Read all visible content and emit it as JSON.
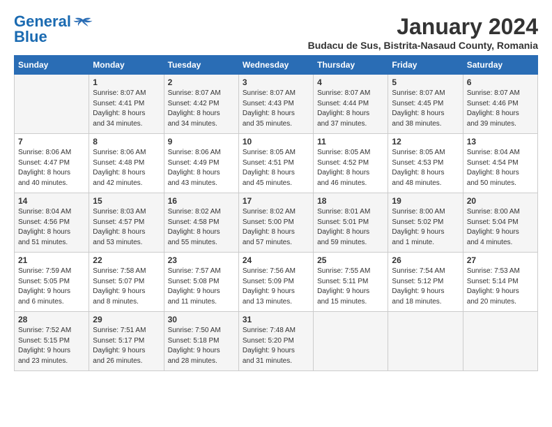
{
  "header": {
    "logo_line1": "General",
    "logo_line2": "Blue",
    "title": "January 2024",
    "subtitle": "Budacu de Sus, Bistrita-Nasaud County, Romania"
  },
  "weekdays": [
    "Sunday",
    "Monday",
    "Tuesday",
    "Wednesday",
    "Thursday",
    "Friday",
    "Saturday"
  ],
  "weeks": [
    [
      {
        "day": "",
        "info": ""
      },
      {
        "day": "1",
        "info": "Sunrise: 8:07 AM\nSunset: 4:41 PM\nDaylight: 8 hours\nand 34 minutes."
      },
      {
        "day": "2",
        "info": "Sunrise: 8:07 AM\nSunset: 4:42 PM\nDaylight: 8 hours\nand 34 minutes."
      },
      {
        "day": "3",
        "info": "Sunrise: 8:07 AM\nSunset: 4:43 PM\nDaylight: 8 hours\nand 35 minutes."
      },
      {
        "day": "4",
        "info": "Sunrise: 8:07 AM\nSunset: 4:44 PM\nDaylight: 8 hours\nand 37 minutes."
      },
      {
        "day": "5",
        "info": "Sunrise: 8:07 AM\nSunset: 4:45 PM\nDaylight: 8 hours\nand 38 minutes."
      },
      {
        "day": "6",
        "info": "Sunrise: 8:07 AM\nSunset: 4:46 PM\nDaylight: 8 hours\nand 39 minutes."
      }
    ],
    [
      {
        "day": "7",
        "info": "Sunrise: 8:06 AM\nSunset: 4:47 PM\nDaylight: 8 hours\nand 40 minutes."
      },
      {
        "day": "8",
        "info": "Sunrise: 8:06 AM\nSunset: 4:48 PM\nDaylight: 8 hours\nand 42 minutes."
      },
      {
        "day": "9",
        "info": "Sunrise: 8:06 AM\nSunset: 4:49 PM\nDaylight: 8 hours\nand 43 minutes."
      },
      {
        "day": "10",
        "info": "Sunrise: 8:05 AM\nSunset: 4:51 PM\nDaylight: 8 hours\nand 45 minutes."
      },
      {
        "day": "11",
        "info": "Sunrise: 8:05 AM\nSunset: 4:52 PM\nDaylight: 8 hours\nand 46 minutes."
      },
      {
        "day": "12",
        "info": "Sunrise: 8:05 AM\nSunset: 4:53 PM\nDaylight: 8 hours\nand 48 minutes."
      },
      {
        "day": "13",
        "info": "Sunrise: 8:04 AM\nSunset: 4:54 PM\nDaylight: 8 hours\nand 50 minutes."
      }
    ],
    [
      {
        "day": "14",
        "info": "Sunrise: 8:04 AM\nSunset: 4:56 PM\nDaylight: 8 hours\nand 51 minutes."
      },
      {
        "day": "15",
        "info": "Sunrise: 8:03 AM\nSunset: 4:57 PM\nDaylight: 8 hours\nand 53 minutes."
      },
      {
        "day": "16",
        "info": "Sunrise: 8:02 AM\nSunset: 4:58 PM\nDaylight: 8 hours\nand 55 minutes."
      },
      {
        "day": "17",
        "info": "Sunrise: 8:02 AM\nSunset: 5:00 PM\nDaylight: 8 hours\nand 57 minutes."
      },
      {
        "day": "18",
        "info": "Sunrise: 8:01 AM\nSunset: 5:01 PM\nDaylight: 8 hours\nand 59 minutes."
      },
      {
        "day": "19",
        "info": "Sunrise: 8:00 AM\nSunset: 5:02 PM\nDaylight: 9 hours\nand 1 minute."
      },
      {
        "day": "20",
        "info": "Sunrise: 8:00 AM\nSunset: 5:04 PM\nDaylight: 9 hours\nand 4 minutes."
      }
    ],
    [
      {
        "day": "21",
        "info": "Sunrise: 7:59 AM\nSunset: 5:05 PM\nDaylight: 9 hours\nand 6 minutes."
      },
      {
        "day": "22",
        "info": "Sunrise: 7:58 AM\nSunset: 5:07 PM\nDaylight: 9 hours\nand 8 minutes."
      },
      {
        "day": "23",
        "info": "Sunrise: 7:57 AM\nSunset: 5:08 PM\nDaylight: 9 hours\nand 11 minutes."
      },
      {
        "day": "24",
        "info": "Sunrise: 7:56 AM\nSunset: 5:09 PM\nDaylight: 9 hours\nand 13 minutes."
      },
      {
        "day": "25",
        "info": "Sunrise: 7:55 AM\nSunset: 5:11 PM\nDaylight: 9 hours\nand 15 minutes."
      },
      {
        "day": "26",
        "info": "Sunrise: 7:54 AM\nSunset: 5:12 PM\nDaylight: 9 hours\nand 18 minutes."
      },
      {
        "day": "27",
        "info": "Sunrise: 7:53 AM\nSunset: 5:14 PM\nDaylight: 9 hours\nand 20 minutes."
      }
    ],
    [
      {
        "day": "28",
        "info": "Sunrise: 7:52 AM\nSunset: 5:15 PM\nDaylight: 9 hours\nand 23 minutes."
      },
      {
        "day": "29",
        "info": "Sunrise: 7:51 AM\nSunset: 5:17 PM\nDaylight: 9 hours\nand 26 minutes."
      },
      {
        "day": "30",
        "info": "Sunrise: 7:50 AM\nSunset: 5:18 PM\nDaylight: 9 hours\nand 28 minutes."
      },
      {
        "day": "31",
        "info": "Sunrise: 7:48 AM\nSunset: 5:20 PM\nDaylight: 9 hours\nand 31 minutes."
      },
      {
        "day": "",
        "info": ""
      },
      {
        "day": "",
        "info": ""
      },
      {
        "day": "",
        "info": ""
      }
    ]
  ]
}
